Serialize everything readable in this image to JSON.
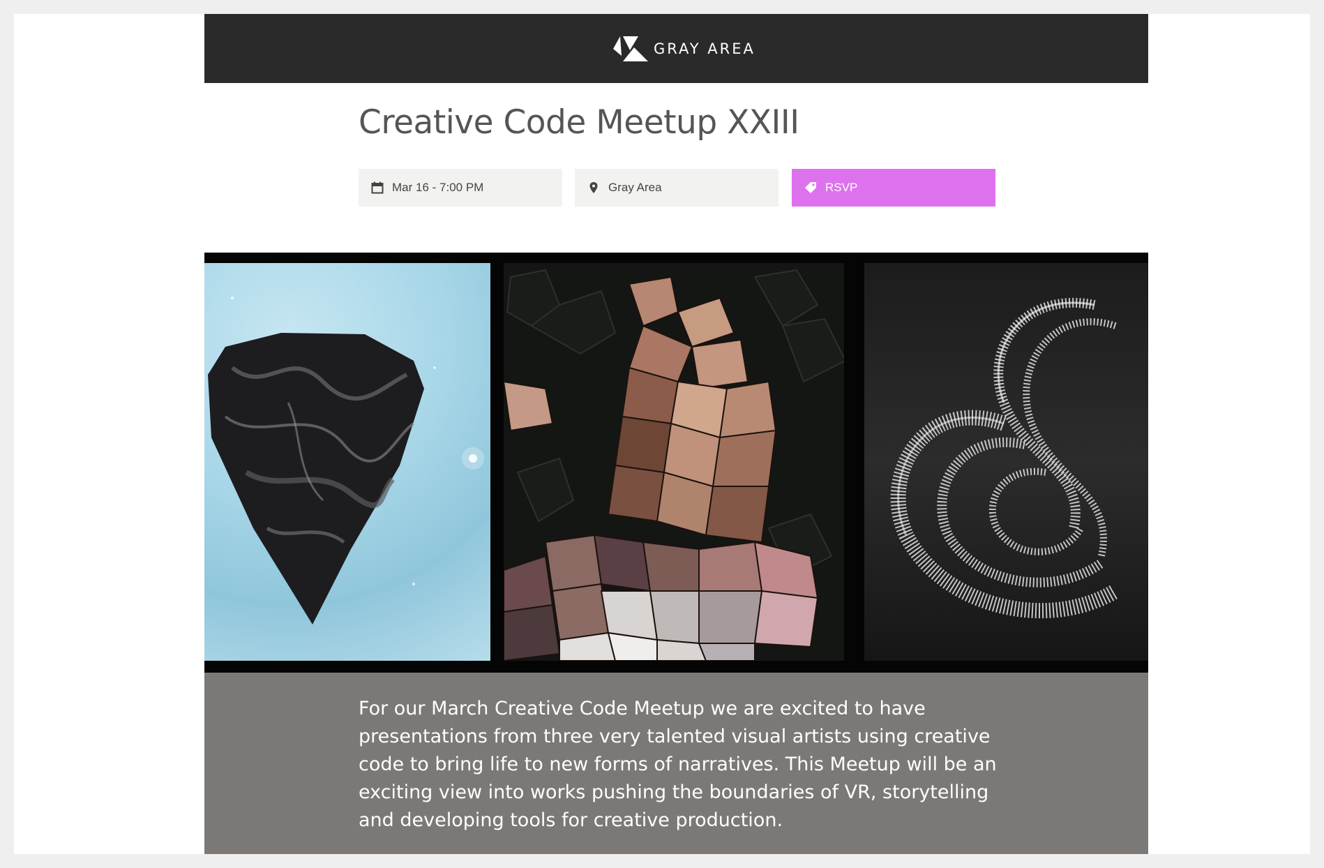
{
  "header": {
    "logo_text": "GRAY AREA",
    "logo_icon": "gray-area-logo-icon",
    "background_color": "#2a2a2a"
  },
  "event": {
    "title": "Creative Code Meetup XXIII",
    "date_label": "Mar 16 - 7:00 PM",
    "date_icon": "calendar-icon",
    "location_label": "Gray Area",
    "location_icon": "map-pin-icon",
    "rsvp_label": "RSVP",
    "rsvp_icon": "ticket-icon",
    "rsvp_color": "#de72ee"
  },
  "hero": {
    "panels": [
      "abstract-rock-artwork",
      "voronoi-portrait-artwork",
      "spiral-3d-artwork"
    ]
  },
  "description": {
    "text": "For our March Creative Code Meetup we are excited to have presentations from three very talented visual artists using creative code to bring life to new forms of narratives. This Meetup will be an exciting view into works pushing the boundaries of VR, storytelling and developing tools for creative production.",
    "background_color": "#7c7876"
  }
}
